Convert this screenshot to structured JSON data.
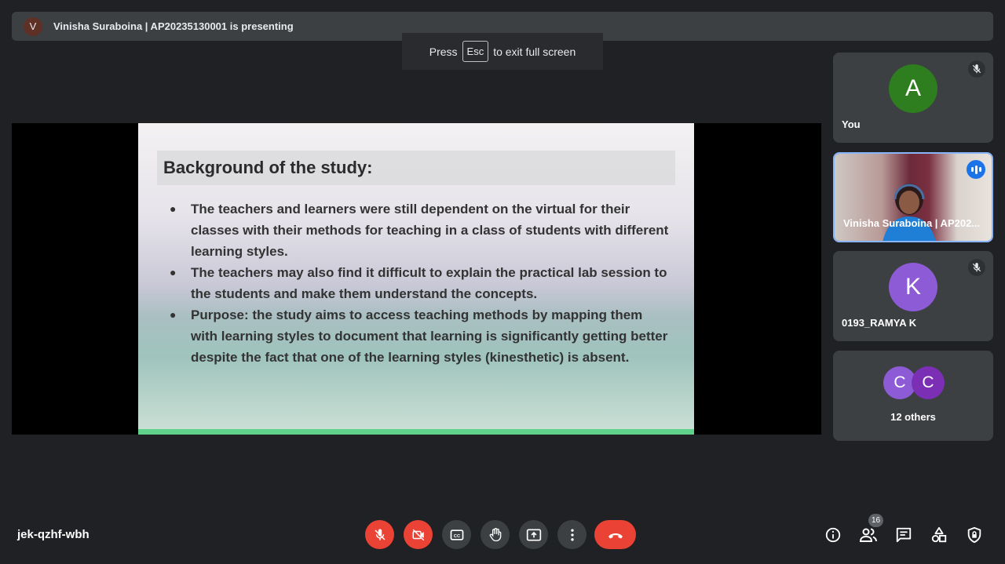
{
  "presenter": {
    "initial": "V",
    "text": "Vinisha Suraboina | AP20235130001 is presenting"
  },
  "toast": {
    "press": "Press",
    "key": "Esc",
    "rest": "to exit full screen"
  },
  "slide": {
    "title": "Background of the study:",
    "bullets": [
      "The teachers and learners were still dependent on the virtual for their classes with their methods for teaching in a class of students with different learning styles.",
      "The teachers may also find it difficult to explain the practical lab session to the students and make them understand the concepts.",
      "Purpose: the study aims to access teaching methods by mapping them with learning styles to document that learning is significantly getting better despite the fact that one of the learning styles (kinesthetic) is absent."
    ]
  },
  "participants": {
    "you": {
      "initial": "A",
      "name": "You",
      "color": "#2e7d1f"
    },
    "presenter": {
      "name": "Vinisha Suraboina | AP202..."
    },
    "ramya": {
      "initial": "K",
      "name": "0193_RAMYA K",
      "color": "#8e5bd6"
    },
    "others": {
      "initial_1": "C",
      "initial_2": "C",
      "label": "12 others",
      "color_1": "#8e5bd6",
      "color_2": "#7b2fb5"
    }
  },
  "meeting_code": "jek-qzhf-wbh",
  "people_count": "16",
  "colors": {
    "danger": "#ea4335",
    "control_bg": "#3c4043",
    "background": "#202124",
    "accent": "#1a73e8"
  },
  "icons": {
    "controls": [
      "mic-off-icon",
      "camera-off-icon",
      "captions-icon",
      "raise-hand-icon",
      "present-icon",
      "more-options-icon",
      "end-call-icon"
    ],
    "right": [
      "info-icon",
      "people-icon",
      "chat-icon",
      "activities-icon",
      "host-controls-icon"
    ]
  }
}
